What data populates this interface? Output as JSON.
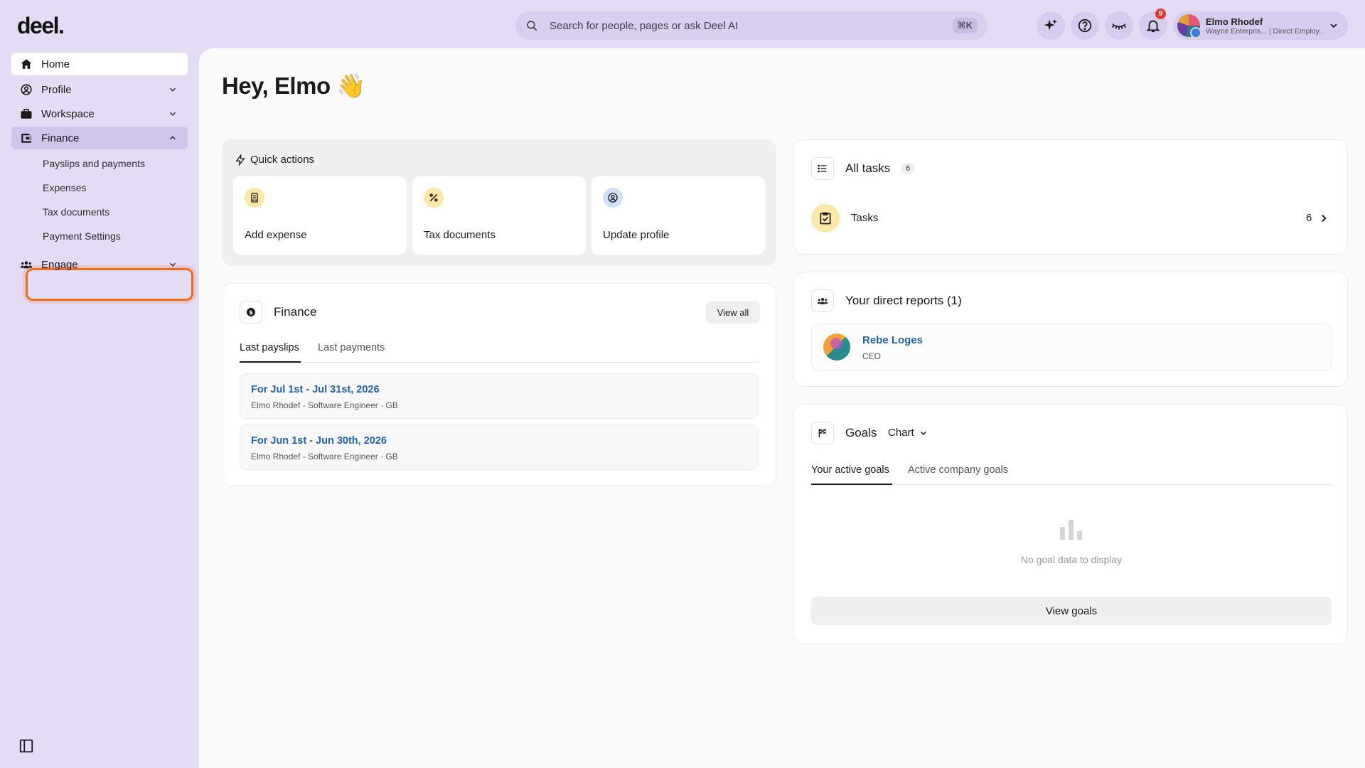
{
  "header": {
    "logo": "deel.",
    "search_placeholder": "Search for people, pages or ask Deel AI",
    "search_shortcut": "⌘K",
    "notification_count": "9",
    "user": {
      "name": "Elmo Rhodef",
      "subtitle": "Wayne Enterpris... | Direct Employ..."
    }
  },
  "sidebar": {
    "items": [
      {
        "label": "Home",
        "icon": "home-icon"
      },
      {
        "label": "Profile",
        "icon": "profile-icon"
      },
      {
        "label": "Workspace",
        "icon": "briefcase-icon"
      },
      {
        "label": "Finance",
        "icon": "wallet-icon"
      },
      {
        "label": "Engage",
        "icon": "people-icon"
      }
    ],
    "finance_sub": [
      "Payslips and payments",
      "Expenses",
      "Tax documents",
      "Payment Settings"
    ]
  },
  "main": {
    "greeting": "Hey, Elmo 👋",
    "quick_actions": {
      "title": "Quick actions",
      "items": [
        {
          "label": "Add expense",
          "icon": "receipt-icon"
        },
        {
          "label": "Tax documents",
          "icon": "percent-icon"
        },
        {
          "label": "Update profile",
          "icon": "user-circle-icon"
        }
      ]
    },
    "finance": {
      "title": "Finance",
      "view_all": "View all",
      "tabs": [
        "Last payslips",
        "Last payments"
      ],
      "payslips": [
        {
          "title": "For Jul 1st - Jul 31st, 2026",
          "subtitle": "Elmo Rhodef - Software Engineer · GB"
        },
        {
          "title": "For Jun 1st - Jun 30th, 2026",
          "subtitle": "Elmo Rhodef - Software Engineer · GB"
        }
      ]
    },
    "tasks": {
      "title": "All tasks",
      "count": "6",
      "row_label": "Tasks",
      "row_count": "6"
    },
    "reports": {
      "title": "Your direct reports (1)",
      "person": {
        "name": "Rebe Loges",
        "role": "CEO"
      }
    },
    "goals": {
      "title": "Goals",
      "view_selector": "Chart",
      "tabs": [
        "Your active goals",
        "Active company goals"
      ],
      "empty_text": "No goal data to display",
      "view_goals": "View goals"
    }
  },
  "colors": {
    "background": "#e3dcf4",
    "highlight": "#f26b1d",
    "link": "#2162ad",
    "badge": "#e8362b"
  }
}
